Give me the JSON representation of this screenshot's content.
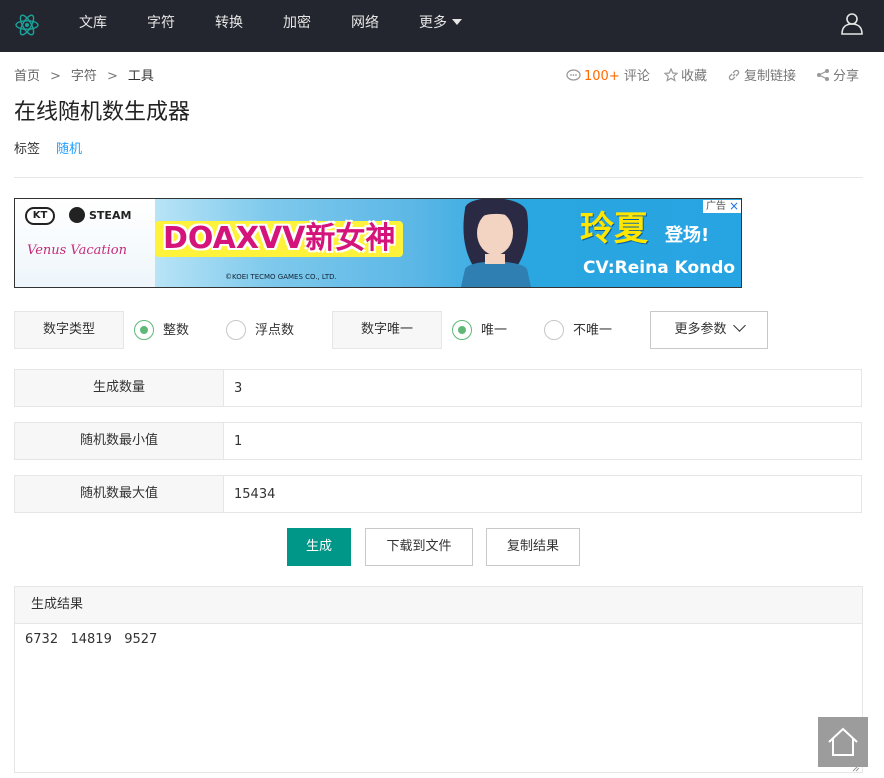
{
  "nav": {
    "items": [
      "文库",
      "字符",
      "转换",
      "加密",
      "网络",
      "更多"
    ]
  },
  "breadcrumb": {
    "items": [
      "首页",
      "字符",
      "工具"
    ],
    "separator": ">"
  },
  "actions": {
    "comment_count": "100+",
    "comment_label": "评论",
    "favorite_label": "收藏",
    "copy_link_label": "复制链接",
    "share_label": "分享"
  },
  "page": {
    "title": "在线随机数生成器",
    "tags_label": "标签",
    "tag": "随机"
  },
  "ad": {
    "badge": "广告",
    "main_text": "DOAXVV新女神",
    "right_title": "玲夏",
    "right_title_suffix": "登场!",
    "right_sub": "CV:Reina Kondo",
    "kt": "KT",
    "steam": "STEAM",
    "venus": "Venus Vacation",
    "copyright": "©KOEI TECMO GAMES CO., LTD."
  },
  "options": {
    "number_type_label": "数字类型",
    "integer_label": "整数",
    "float_label": "浮点数",
    "unique_label": "数字唯一",
    "unique_yes_label": "唯一",
    "unique_no_label": "不唯一",
    "more_params_label": "更多参数",
    "integer_selected": true,
    "unique_selected": true
  },
  "form": {
    "count_label": "生成数量",
    "count_value": "3",
    "min_label": "随机数最小值",
    "min_value": "1",
    "max_label": "随机数最大值",
    "max_value": "15434"
  },
  "buttons": {
    "generate": "生成",
    "download": "下载到文件",
    "copy": "复制结果"
  },
  "result": {
    "title": "生成结果",
    "text": "6732   14819   9527"
  },
  "colors": {
    "nav_bg": "#23262e",
    "primary": "#009688",
    "radio_on": "#5fb878",
    "tag_link": "#1e9fff",
    "comment_count": "#ff6a00"
  },
  "icons": {
    "logo": "atom-logo-icon",
    "user": "user-icon",
    "comment": "comment-icon",
    "favorite": "star-icon",
    "copy_link": "link-icon",
    "share": "share-icon",
    "back_to_top": "home-icon"
  }
}
